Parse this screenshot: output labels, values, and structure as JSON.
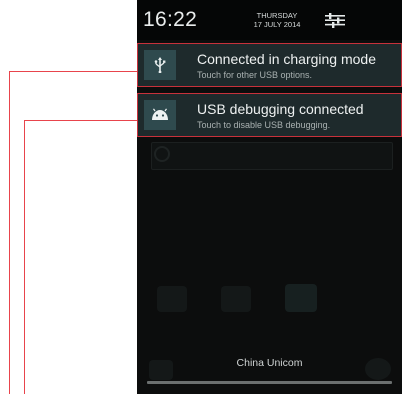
{
  "status": {
    "time": "16:22",
    "day": "THURSDAY",
    "date": "17 JULY 2014"
  },
  "notifications": [
    {
      "icon": "usb-icon",
      "title": "Connected in charging mode",
      "subtitle": "Touch for other USB options."
    },
    {
      "icon": "android-debug-icon",
      "title": "USB debugging connected",
      "subtitle": "Touch to disable USB debugging."
    }
  ],
  "footer": {
    "carrier": "China Unicom"
  },
  "colors": {
    "callout_red": "#e8444c",
    "notification_bg": "#1e2a2c",
    "icon_tile": "#2f4a4e"
  }
}
